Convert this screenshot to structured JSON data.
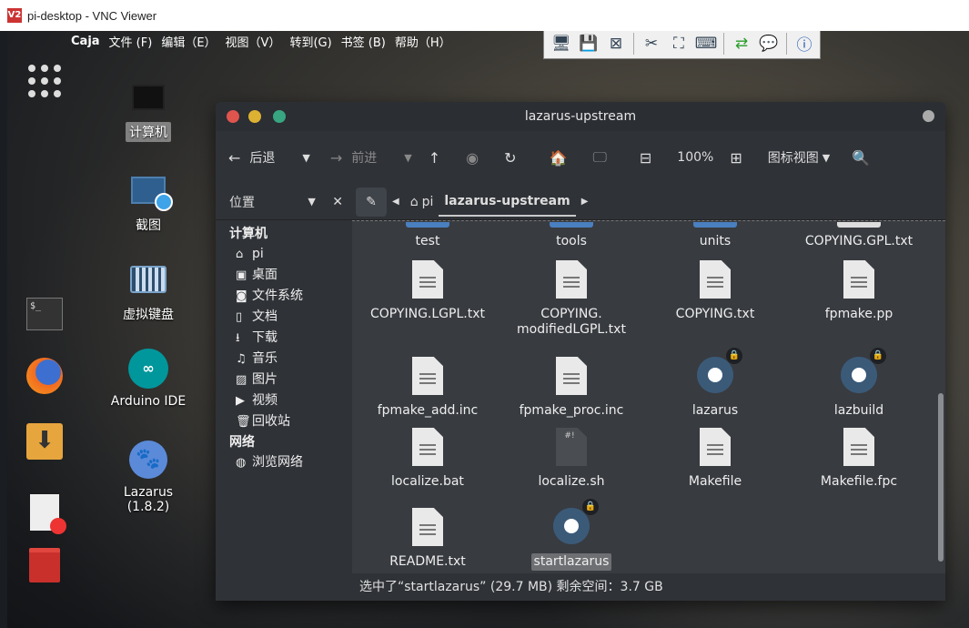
{
  "vnc": {
    "title": "pi-desktop - VNC Viewer",
    "logo": "V2"
  },
  "menubar": {
    "app": "Caja",
    "items": [
      "文件 (F)",
      "编辑（E）",
      "视图（V）",
      "转到(G)",
      "书签 (B)",
      "帮助（H）"
    ]
  },
  "desktop_icons": [
    {
      "label": "计算机",
      "icon": "computer-icon",
      "selected": true
    },
    {
      "label": "截图",
      "icon": "screenshot-icon"
    },
    {
      "label": "虚拟键盘",
      "icon": "keyboard-icon"
    },
    {
      "label": "Arduino IDE",
      "icon": "arduino-icon"
    },
    {
      "label": "Lazarus (1.8.2)",
      "icon": "lazarus-icon"
    }
  ],
  "caja": {
    "title": "lazarus-upstream",
    "toolbar": {
      "back": "后退",
      "forward": "前进",
      "zoom": "100%",
      "view_mode": "图标视图"
    },
    "sidebar": {
      "header": "位置",
      "section_computer": "计算机",
      "computer_items": [
        {
          "label": "pi",
          "icon": "home-icon"
        },
        {
          "label": "桌面",
          "icon": "desktop-icon"
        },
        {
          "label": "文件系统",
          "icon": "drive-icon"
        },
        {
          "label": "文档",
          "icon": "document-icon"
        },
        {
          "label": "下载",
          "icon": "download-icon"
        },
        {
          "label": "音乐",
          "icon": "music-icon"
        },
        {
          "label": "图片",
          "icon": "picture-icon"
        },
        {
          "label": "视频",
          "icon": "video-icon"
        },
        {
          "label": "回收站",
          "icon": "trash-icon"
        }
      ],
      "section_network": "网络",
      "network_items": [
        {
          "label": "浏览网络",
          "icon": "network-icon"
        }
      ]
    },
    "path": {
      "home": "pi",
      "current": "lazarus-upstream"
    },
    "files": [
      {
        "name": "test",
        "type": "folder"
      },
      {
        "name": "tools",
        "type": "folder"
      },
      {
        "name": "units",
        "type": "folder"
      },
      {
        "name": "COPYING.GPL.txt",
        "type": "folder"
      },
      {
        "name": "COPYING.LGPL.txt",
        "type": "text"
      },
      {
        "name": "COPYING.\nmodifiedLGPL.txt",
        "type": "text"
      },
      {
        "name": "COPYING.txt",
        "type": "text"
      },
      {
        "name": "fpmake.pp",
        "type": "text"
      },
      {
        "name": "fpmake_add.inc",
        "type": "text"
      },
      {
        "name": "fpmake_proc.inc",
        "type": "text"
      },
      {
        "name": "lazarus",
        "type": "exec"
      },
      {
        "name": "lazbuild",
        "type": "exec"
      },
      {
        "name": "localize.bat",
        "type": "text"
      },
      {
        "name": "localize.sh",
        "type": "script"
      },
      {
        "name": "Makefile",
        "type": "text"
      },
      {
        "name": "Makefile.fpc",
        "type": "text"
      },
      {
        "name": "README.txt",
        "type": "text"
      },
      {
        "name": "startlazarus",
        "type": "exec",
        "selected": true
      }
    ],
    "status": "选中了“startlazarus” (29.7 MB) 剩余空间：3.7 GB"
  }
}
